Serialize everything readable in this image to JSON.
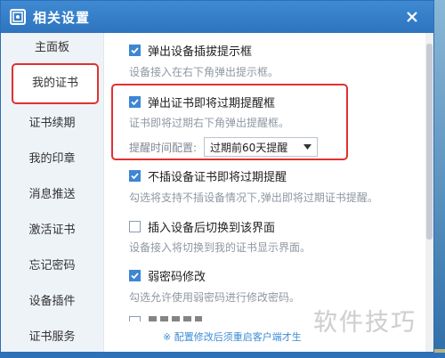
{
  "window": {
    "title": "相关设置",
    "icons": {
      "app": "settings-app-icon",
      "close": "close-icon"
    }
  },
  "sidebar": {
    "items": [
      {
        "label": "主面板"
      },
      {
        "label": "我的证书"
      },
      {
        "label": "证书续期"
      },
      {
        "label": "我的印章"
      },
      {
        "label": "消息推送"
      },
      {
        "label": "激活证书"
      },
      {
        "label": "忘记密码"
      },
      {
        "label": "设备插件"
      },
      {
        "label": "证书服务"
      }
    ],
    "active_index": 1
  },
  "options": [
    {
      "label": "弹出设备插拔提示框",
      "desc": "设备接入在右下角弹出提示框。",
      "checked": true
    },
    {
      "label": "弹出证书即将过期提醒框",
      "desc": "证书即将过期右下角弹出提醒框。",
      "checked": true
    },
    {
      "label": "不插设备证书即将过期提醒",
      "desc": "勾选将支持不插设备情况下,弹出即将过期证书提醒。",
      "checked": true
    },
    {
      "label": "插入设备后切换到该界面",
      "desc": "设备接入将切换到我的证书显示界面。",
      "checked": false
    },
    {
      "label": "弱密码修改",
      "desc": "勾选允许使用弱密码进行修改密码。",
      "checked": true
    }
  ],
  "reminder_config": {
    "label": "提醒时间配置:",
    "selected": "过期前60天提醒"
  },
  "footer_note": "※ 配置修改后须重启客户端才生",
  "watermark": "软件技巧",
  "colors": {
    "titlebar": "#3a82cc",
    "accent": "#3d86d4",
    "highlight": "#e03131"
  }
}
